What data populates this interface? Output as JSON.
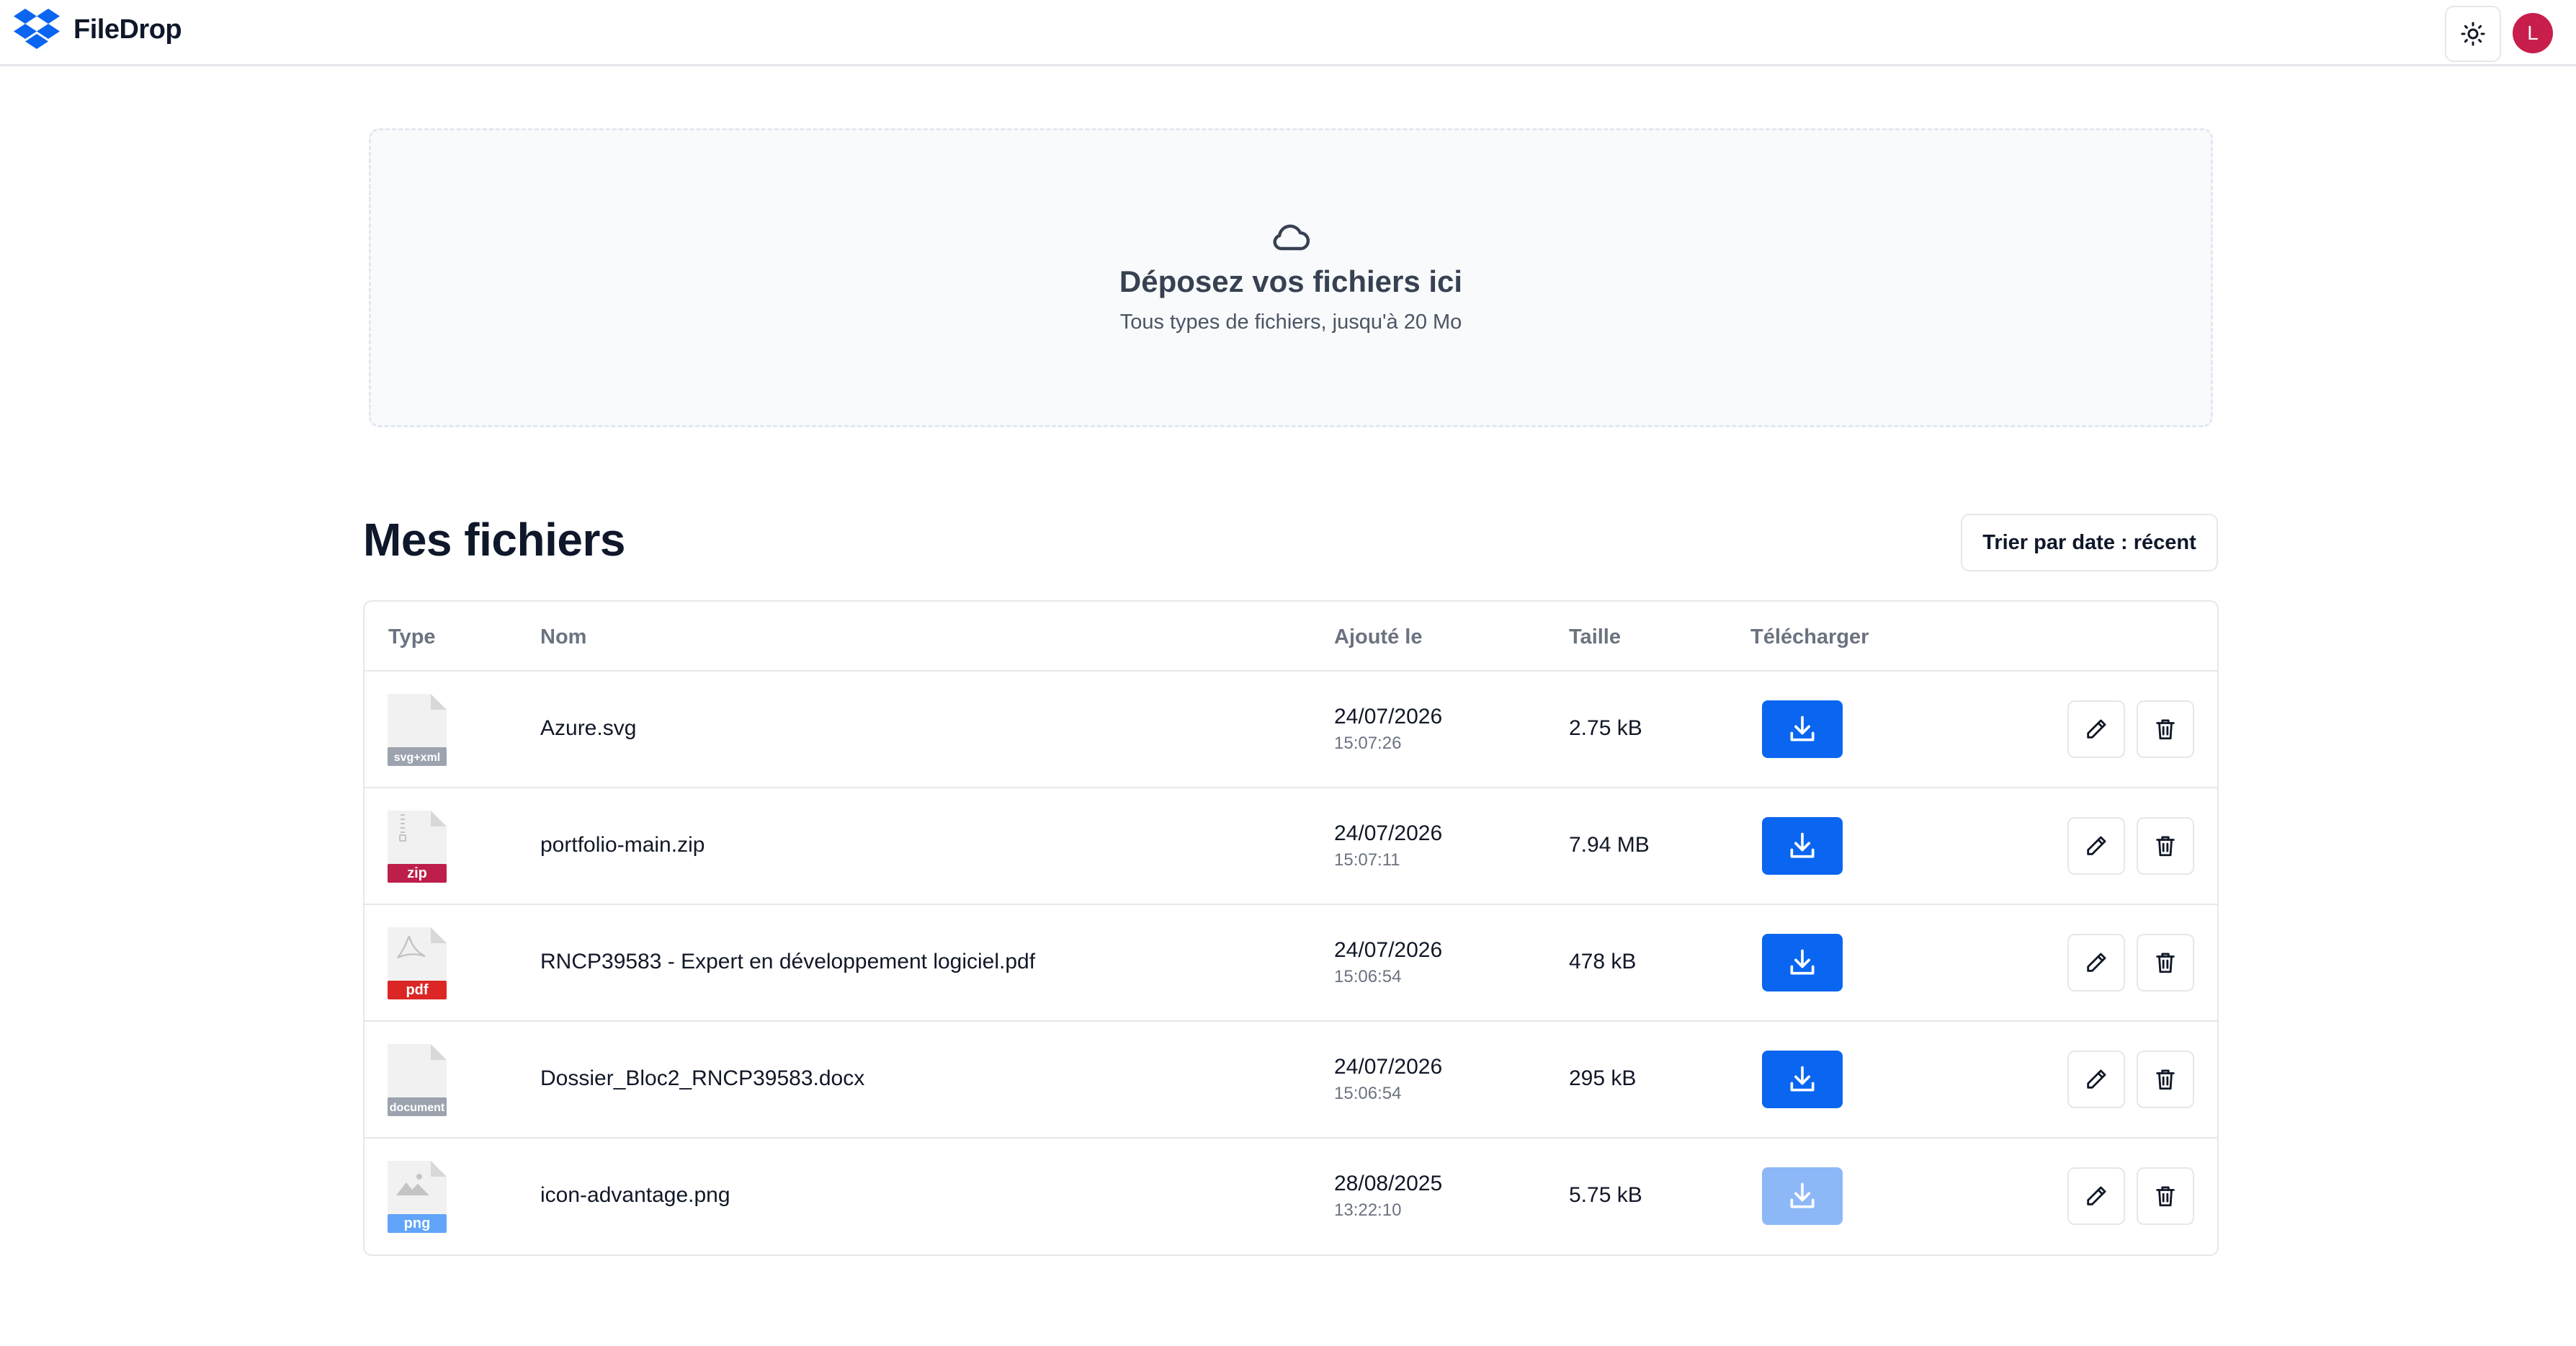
{
  "header": {
    "app_name": "FileDrop",
    "logo_icon": "dropbox-logo-icon",
    "brand_color": "#0a66f0",
    "theme_toggle_icon": "sun-icon",
    "avatar_initial": "L",
    "avatar_color": "#c81e4b"
  },
  "dropzone": {
    "icon": "cloud-icon",
    "title": "Déposez vos fichiers ici",
    "subtitle": "Tous types de fichiers, jusqu'à 20 Mo"
  },
  "files_section": {
    "title": "Mes fichiers",
    "sort_label": "Trier par date : récent",
    "columns": {
      "type": "Type",
      "name": "Nom",
      "added": "Ajouté le",
      "size": "Taille",
      "download": "Télécharger"
    },
    "rows": [
      {
        "badge": "svg+xml",
        "badge_color": "#9ca3af",
        "glyph": "none",
        "name": "Azure.svg",
        "date": "24/07/2026",
        "time": "15:07:26",
        "size": "2.75 kB",
        "download_enabled": true
      },
      {
        "badge": "zip",
        "badge_color": "#be1e4a",
        "glyph": "zipper",
        "name": "portfolio-main.zip",
        "date": "24/07/2026",
        "time": "15:07:11",
        "size": "7.94 MB",
        "download_enabled": true
      },
      {
        "badge": "pdf",
        "badge_color": "#dc2626",
        "glyph": "acrobat",
        "name": "RNCP39583 - Expert en développement logiciel.pdf",
        "date": "24/07/2026",
        "time": "15:06:54",
        "size": "478 kB",
        "download_enabled": true
      },
      {
        "badge": "document",
        "badge_color": "#9ca3af",
        "glyph": "none",
        "name": "Dossier_Bloc2_RNCP39583.docx",
        "date": "24/07/2026",
        "time": "15:06:54",
        "size": "295 kB",
        "download_enabled": true
      },
      {
        "badge": "png",
        "badge_color": "#60a5fa",
        "glyph": "image",
        "name": "icon-advantage.png",
        "date": "28/08/2025",
        "time": "13:22:10",
        "size": "5.75 kB",
        "download_enabled": false
      }
    ],
    "row_action_icons": {
      "download": "download-icon",
      "edit": "pencil-icon",
      "delete": "trash-icon"
    }
  }
}
